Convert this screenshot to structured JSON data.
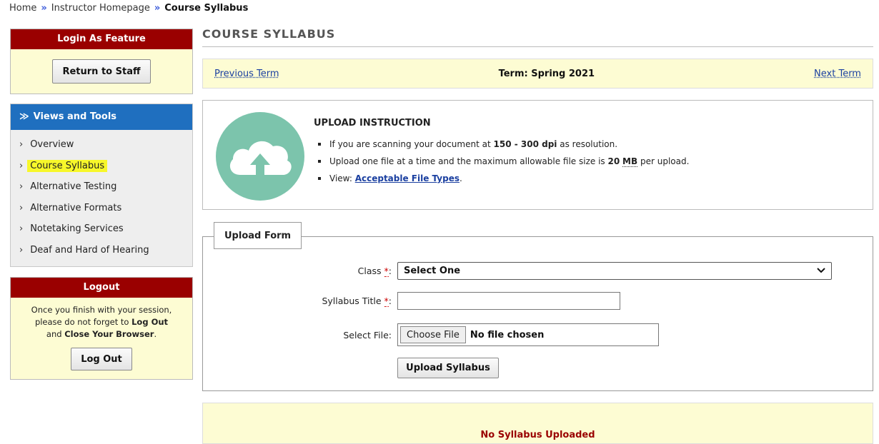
{
  "breadcrumb": {
    "home": "Home",
    "instructor": "Instructor Homepage",
    "current": "Course Syllabus",
    "sep": "»"
  },
  "sidebar": {
    "login_feature": {
      "title": "Login As Feature",
      "button": "Return to Staff"
    },
    "views": {
      "title": "Views and Tools",
      "items": [
        {
          "label": "Overview"
        },
        {
          "label": "Course Syllabus",
          "highlighted": true
        },
        {
          "label": "Alternative Testing"
        },
        {
          "label": "Alternative Formats"
        },
        {
          "label": "Notetaking Services"
        },
        {
          "label": "Deaf and Hard of Hearing"
        }
      ]
    },
    "logout": {
      "title": "Logout",
      "msg1": "Once you finish with your session,",
      "msg2": "please do not forget to",
      "msg2b": "Log Out",
      "msg3": "and",
      "msg3b": "Close Your Browser",
      "msg3c": ".",
      "button": "Log Out"
    }
  },
  "main": {
    "title": "COURSE SYLLABUS",
    "term": {
      "prev": "Previous Term",
      "current": "Term: Spring 2021",
      "next": "Next Term"
    },
    "instruction": {
      "heading": "UPLOAD INSTRUCTION",
      "line1_a": "If you are scanning your document at",
      "line1_b": "150 - 300 dpi",
      "line1_c": "as resolution.",
      "line2_a": "Upload one file at a time and the maximum allowable file size is",
      "line2_b": "20",
      "line2_c": "MB",
      "line2_d": "per upload.",
      "line3_a": "View:",
      "line3_link": "Acceptable File Types",
      "line3_end": "."
    },
    "form": {
      "legend": "Upload Form",
      "class_label": "Class",
      "required": "*",
      "colon": ":",
      "class_value": "Select One",
      "title_label": "Syllabus Title",
      "title_value": "",
      "file_label": "Select File:",
      "file_button": "Choose File",
      "file_status": "No file chosen",
      "submit": "Upload Syllabus"
    },
    "status": "No Syllabus Uploaded"
  },
  "colors": {
    "header_red": "#9a0000",
    "views_blue": "#1f6fbf",
    "panel_yellow": "#fdfcd3",
    "highlight": "#f7f72a",
    "cloud": "#7cc4ac",
    "link": "#1a3fa0"
  }
}
